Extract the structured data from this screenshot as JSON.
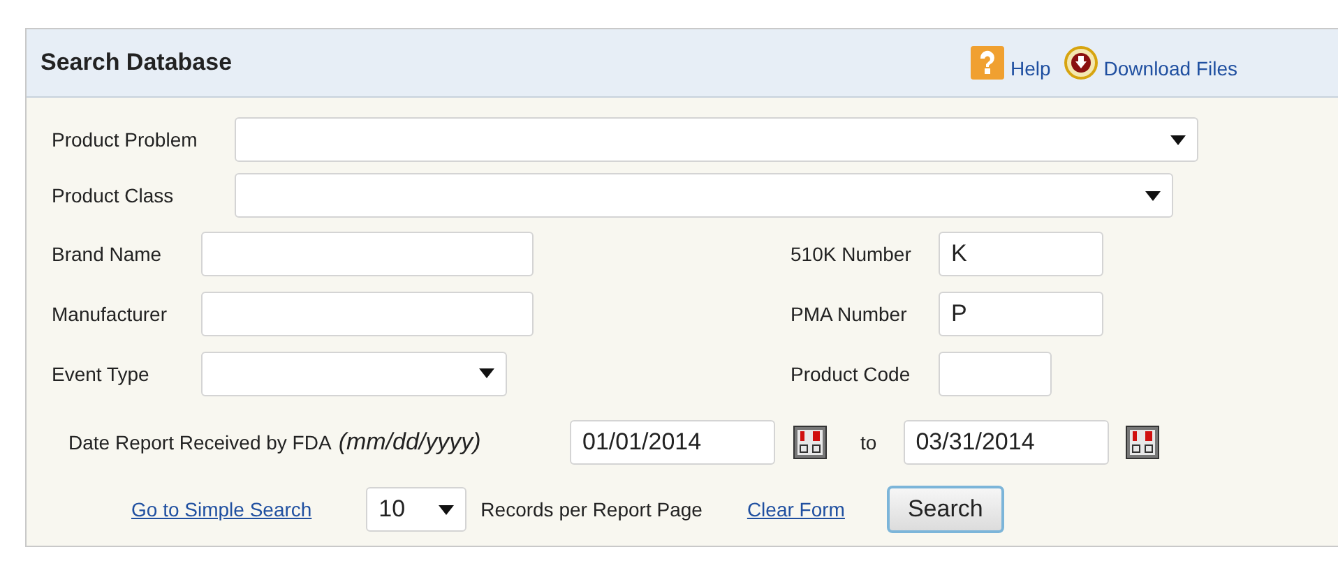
{
  "panel": {
    "title": "Search Database",
    "links": [
      {
        "kind": "help",
        "label": "Help"
      },
      {
        "kind": "download",
        "label": "Download Files"
      }
    ]
  },
  "wide_fields": [
    {
      "label": "Product Problem",
      "kind": "select"
    },
    {
      "label": "Product Class",
      "kind": "select"
    }
  ],
  "left_fields": [
    {
      "label": "Brand Name",
      "kind": "text"
    },
    {
      "label": "Manufacturer",
      "kind": "text"
    },
    {
      "label": "Event Type",
      "kind": "select"
    }
  ],
  "right_fields": [
    {
      "label": "510K Number",
      "value": "K"
    },
    {
      "label": "PMA Number",
      "value": "P"
    },
    {
      "label": "Product Code"
    }
  ],
  "date_range": {
    "label": "Date Report Received by FDA",
    "hint": "(mm/dd/yyyy)",
    "from": "01/01/2014",
    "separator": "to",
    "to": "03/31/2014"
  },
  "footer": {
    "simple_search_link": "Go to Simple Search",
    "records_per_page": "10",
    "records_label": "Records per Report Page",
    "clear_link": "Clear Form",
    "search_button": "Search"
  }
}
